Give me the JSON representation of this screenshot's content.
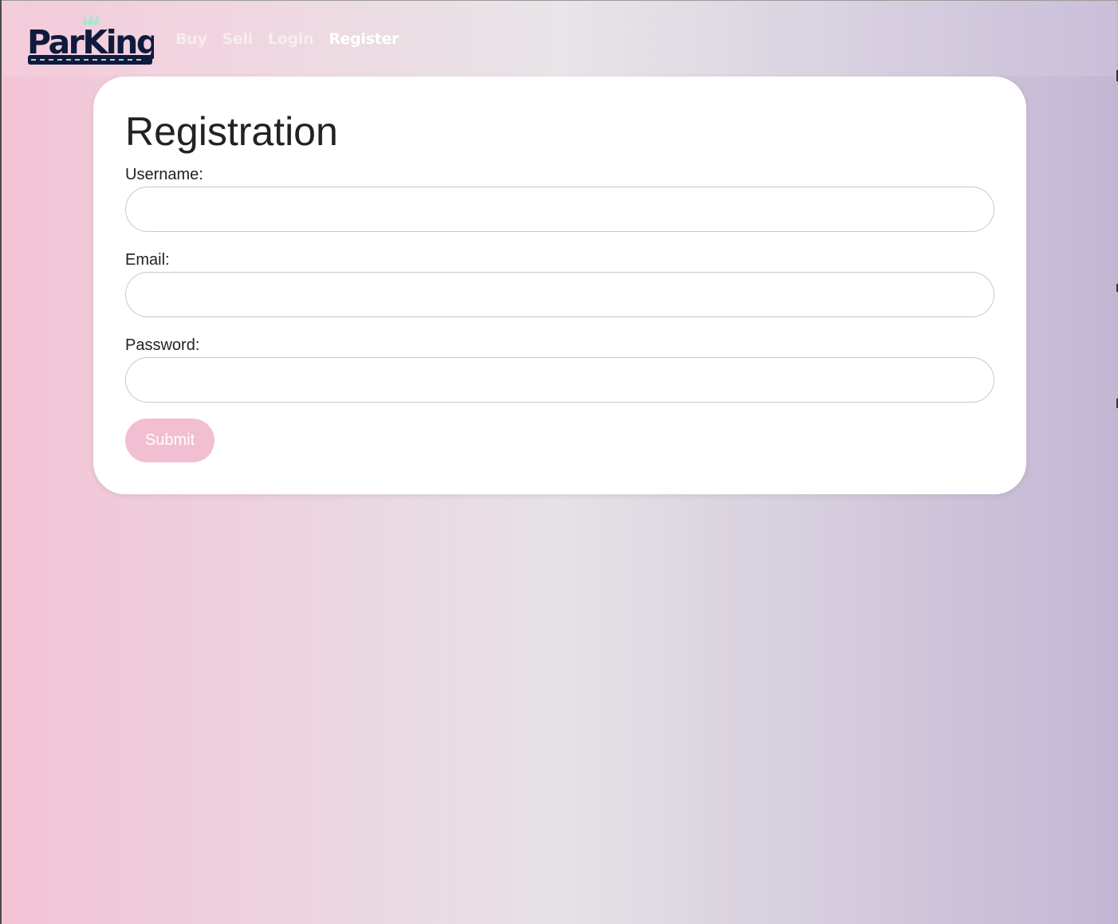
{
  "brand": {
    "logo_text": "ParKing"
  },
  "nav": {
    "links": [
      {
        "label": "Buy"
      },
      {
        "label": "Sell"
      },
      {
        "label": "Login"
      },
      {
        "label": "Register",
        "active": true
      }
    ]
  },
  "form": {
    "title": "Registration",
    "username": {
      "label": "Username:",
      "value": ""
    },
    "email": {
      "label": "Email:",
      "value": ""
    },
    "password": {
      "label": "Password:",
      "value": ""
    },
    "submit_label": "Submit"
  },
  "colors": {
    "gradient_start": "#f3c4d6",
    "gradient_mid": "#e6e2e6",
    "gradient_end": "#c3b6d4",
    "logo_navy": "#0f1b3d",
    "crown_mint": "#a6e8cf",
    "submit_pink": "#f2bfd2"
  }
}
